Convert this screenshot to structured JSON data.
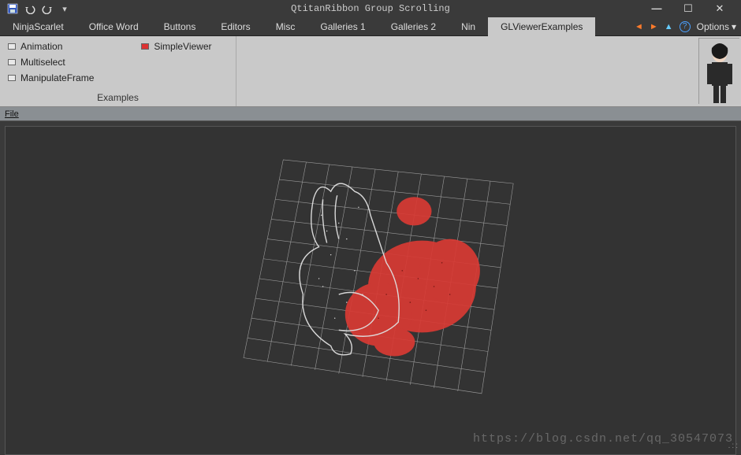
{
  "window": {
    "title": "QtitanRibbon Group Scrolling"
  },
  "quick_access": {
    "save": "save",
    "undo": "undo",
    "redo": "redo",
    "customize": "customize"
  },
  "tabs": [
    {
      "label": "NinjaScarlet",
      "active": false
    },
    {
      "label": "Office Word",
      "active": false
    },
    {
      "label": "Buttons",
      "active": false
    },
    {
      "label": "Editors",
      "active": false
    },
    {
      "label": "Misc",
      "active": false
    },
    {
      "label": "Galleries 1",
      "active": false
    },
    {
      "label": "Galleries 2",
      "active": false
    },
    {
      "label": "Nin",
      "active": false
    },
    {
      "label": "GLViewerExamples",
      "active": true
    }
  ],
  "tab_scroll": {
    "back": "◄",
    "forward": "►",
    "up": "▲",
    "help": "?",
    "options_label": "Options"
  },
  "ribbon": {
    "group_title": "Examples",
    "items_col1": [
      {
        "label": "Animation"
      },
      {
        "label": "Multiselect"
      },
      {
        "label": "ManipulateFrame"
      }
    ],
    "items_col2": [
      {
        "label": "SimpleViewer"
      }
    ]
  },
  "menubar": {
    "file": "File"
  },
  "watermark": "https://blog.csdn.net/qq_30547073",
  "colors": {
    "bg": "#333333",
    "grid": "#9a9a9a",
    "points_white": "#e0e0e0",
    "points_red": "#d83a34"
  }
}
